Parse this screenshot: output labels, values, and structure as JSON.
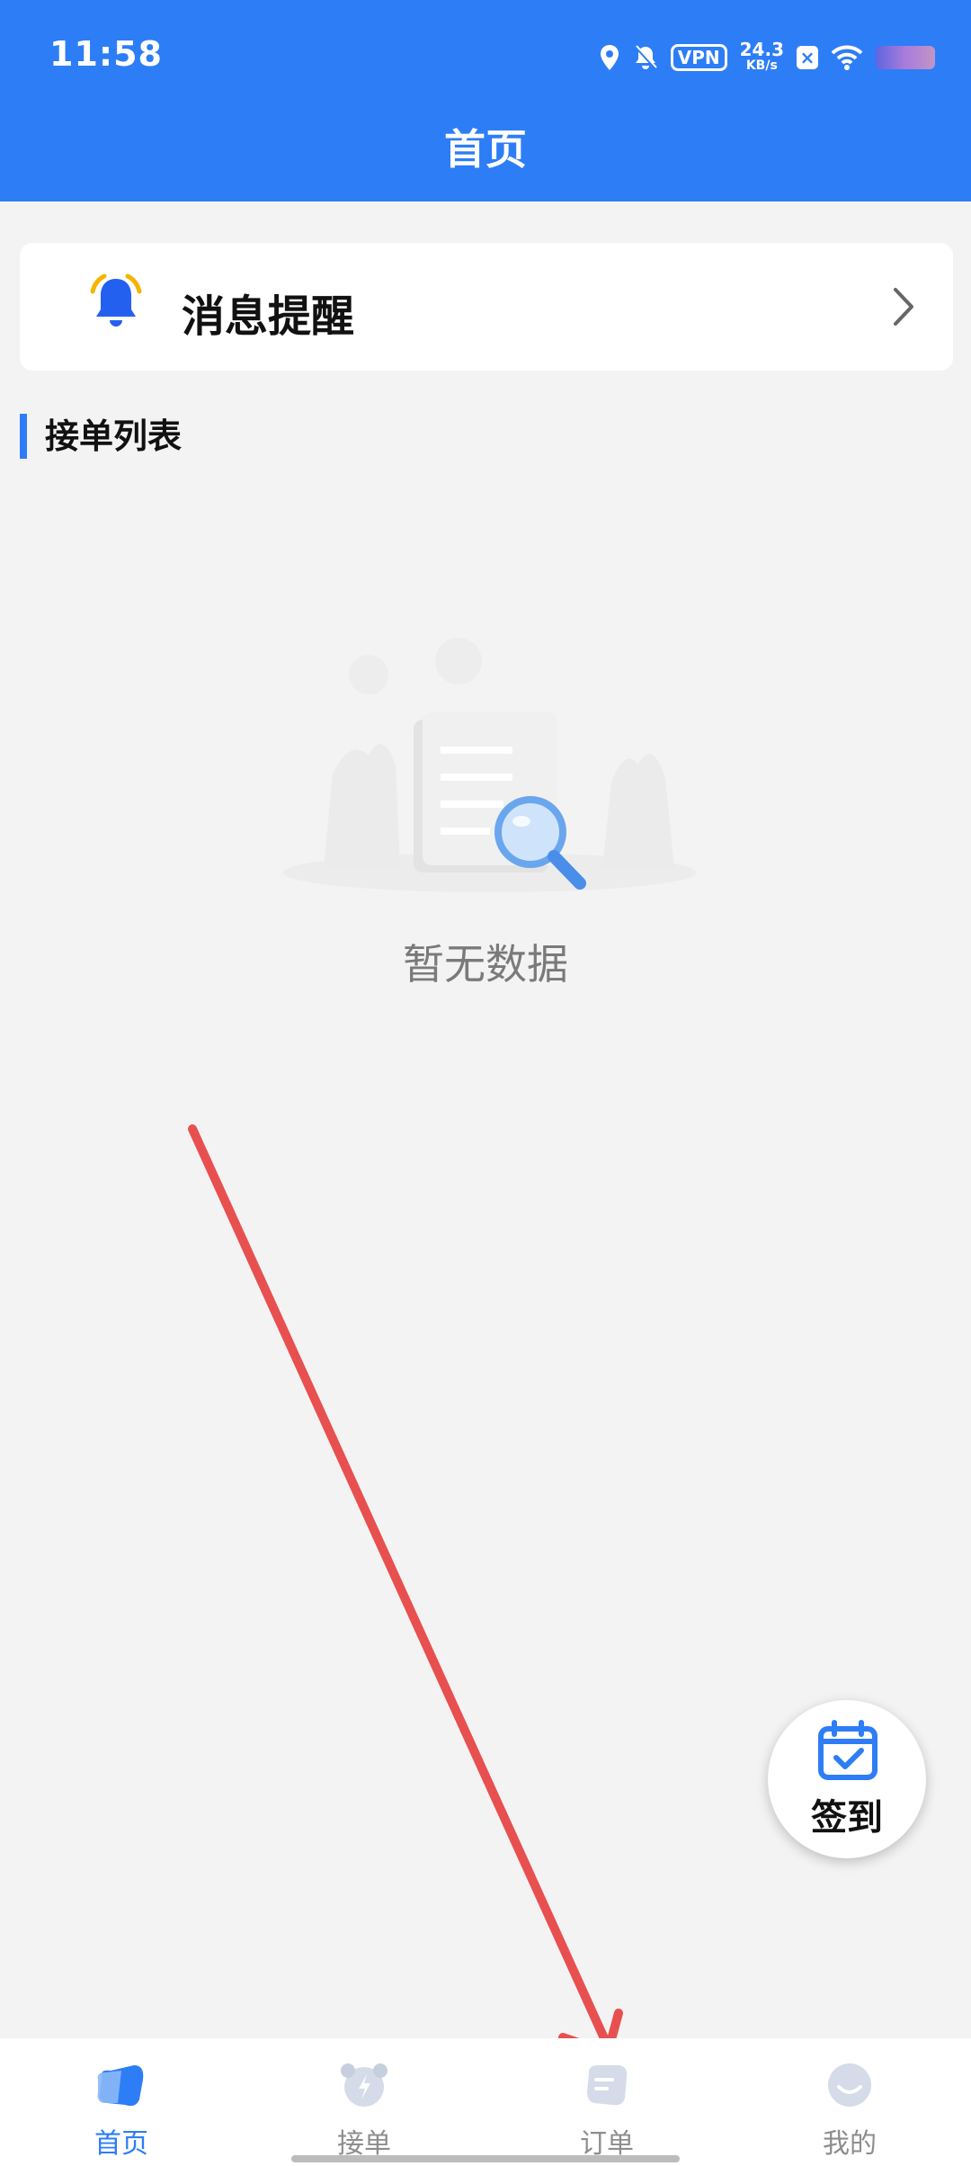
{
  "status_bar": {
    "time": "11:58",
    "vpn": "VPN",
    "speed_value": "24.3",
    "speed_unit": "KB/s"
  },
  "header": {
    "title": "首页"
  },
  "message_card": {
    "label": "消息提醒"
  },
  "section": {
    "title": "接单列表"
  },
  "empty_state": {
    "text": "暂无数据"
  },
  "checkin_button": {
    "label": "签到"
  },
  "tabbar": {
    "tabs": [
      {
        "label": "首页",
        "icon": "home-icon",
        "active": true
      },
      {
        "label": "接单",
        "icon": "grab-order-icon",
        "active": false
      },
      {
        "label": "订单",
        "icon": "order-icon",
        "active": false
      },
      {
        "label": "我的",
        "icon": "profile-icon",
        "active": false
      }
    ]
  },
  "colors": {
    "primary": "#2d7df6",
    "background": "#f4f3f4",
    "annotation_arrow": "#e8504f"
  }
}
